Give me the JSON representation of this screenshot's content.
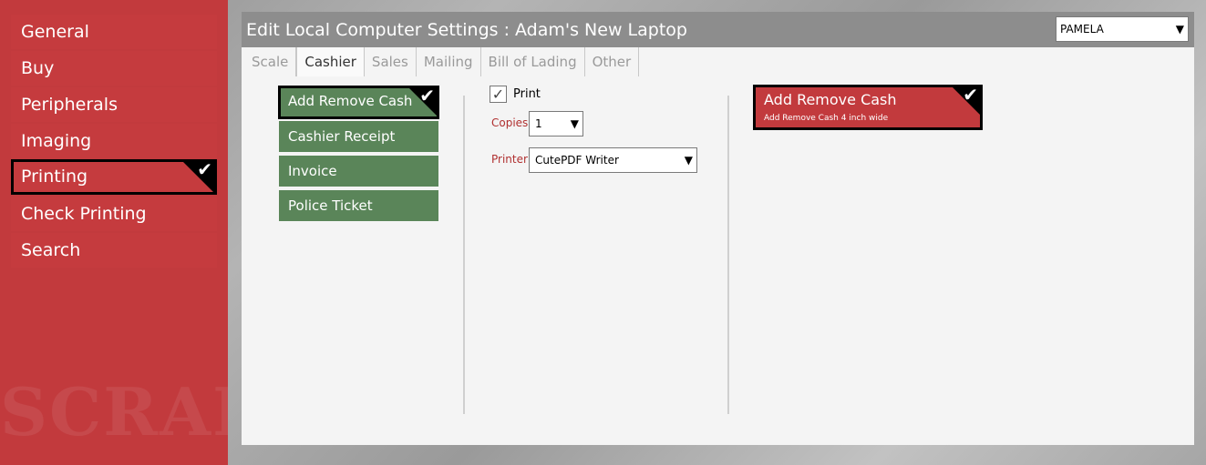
{
  "sidebar": {
    "items": [
      {
        "label": "General"
      },
      {
        "label": "Buy"
      },
      {
        "label": "Peripherals"
      },
      {
        "label": "Imaging"
      },
      {
        "label": "Printing",
        "selected": true
      },
      {
        "label": "Check Printing"
      },
      {
        "label": "Search"
      }
    ],
    "watermark": "SCRAP"
  },
  "header": {
    "title": "Edit Local Computer Settings :  Adam's New Laptop",
    "user_select_value": "PAMELA"
  },
  "tabs": [
    {
      "label": "Scale"
    },
    {
      "label": "Cashier",
      "active": true
    },
    {
      "label": "Sales"
    },
    {
      "label": "Mailing"
    },
    {
      "label": "Bill of Lading"
    },
    {
      "label": "Other"
    }
  ],
  "documents": [
    {
      "label": "Add Remove Cash",
      "selected": true
    },
    {
      "label": "Cashier Receipt"
    },
    {
      "label": "Invoice"
    },
    {
      "label": "Police Ticket"
    }
  ],
  "print_settings": {
    "print_label": "Print",
    "print_checked": true,
    "copies_label": "Copies",
    "copies_value": "1",
    "printer_label": "Printer",
    "printer_value": "CutePDF Writer"
  },
  "template_card": {
    "title": "Add Remove Cash",
    "description": "Add Remove Cash 4 inch wide",
    "selected": true
  },
  "colors": {
    "sidebar_red": "#c23a3d",
    "doc_green": "#5a8559",
    "header_gray": "#8d8d8d"
  }
}
